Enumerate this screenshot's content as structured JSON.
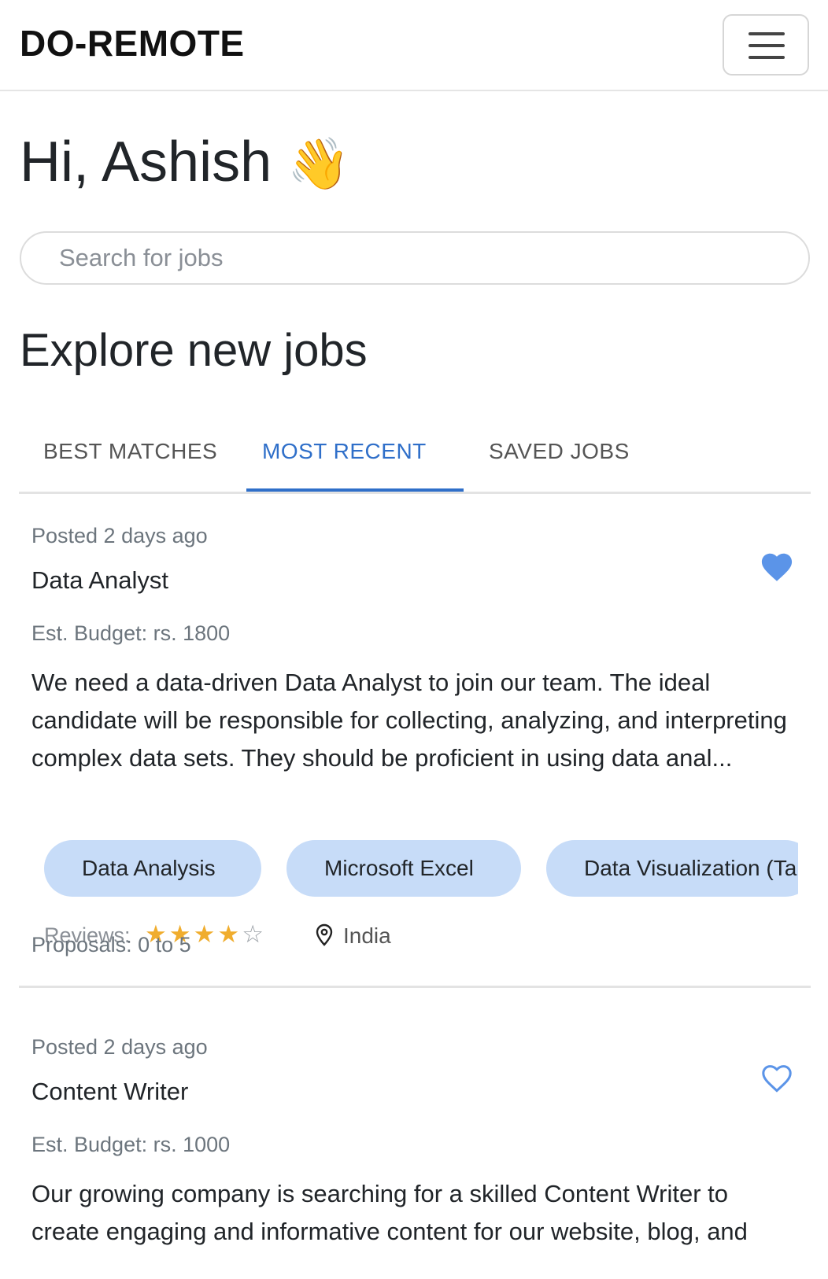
{
  "navbar": {
    "brand": "DO-REMOTE",
    "menu_icon": "hamburger-menu-icon"
  },
  "greeting": {
    "text": "Hi, Ashish",
    "emoji": "👋"
  },
  "search": {
    "placeholder": "Search for jobs",
    "value": ""
  },
  "section_title": "Explore new jobs",
  "tabs": [
    {
      "label": "BEST MATCHES",
      "active": false
    },
    {
      "label": "MOST RECENT",
      "active": true
    },
    {
      "label": "SAVED JOBS",
      "active": false
    }
  ],
  "accent_color": "#2f6fc9",
  "skill_chip_color": "#c7dcf8",
  "jobs": [
    {
      "posted": "Posted 2 days ago",
      "title": "Data Analyst",
      "saved": true,
      "budget": "Est. Budget: rs. 1800",
      "description": "We need a data-driven Data Analyst to join our team. The ideal candidate will be responsible for collecting, analyzing, and interpreting complex data sets. They should be proficient in using data anal...",
      "skills": [
        "Data Analysis",
        "Microsoft Excel",
        "Data Visualization (Ta"
      ],
      "reviews_label": "Reviews:",
      "rating": 4,
      "rating_max": 5,
      "location": "India",
      "proposals": "Proposals: 0 to 5"
    },
    {
      "posted": "Posted 2 days ago",
      "title": "Content Writer",
      "saved": false,
      "budget": "Est. Budget: rs. 1000",
      "description": "Our growing company is searching for a skilled Content Writer to create engaging and informative content for our website, blog, and"
    }
  ]
}
